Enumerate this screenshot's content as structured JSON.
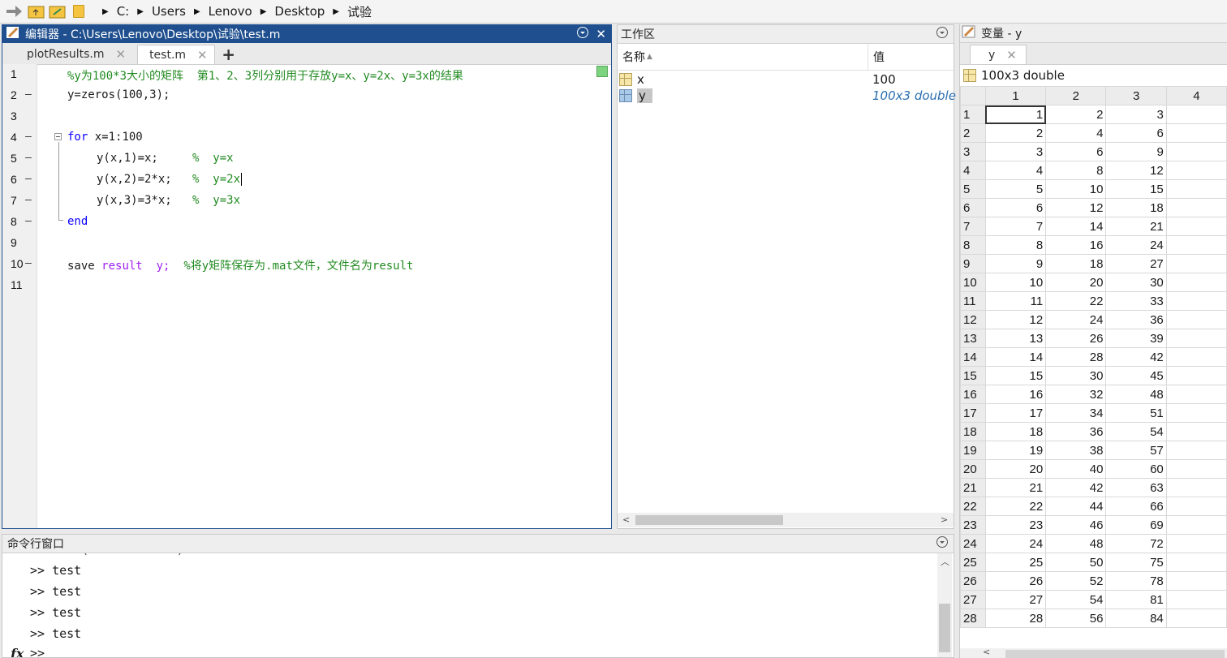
{
  "address_bar": {
    "crumbs": [
      "C:",
      "Users",
      "Lenovo",
      "Desktop",
      "试验"
    ]
  },
  "editor": {
    "title": "编辑器 - C:\\Users\\Lenovo\\Desktop\\试验\\test.m",
    "tabs": [
      {
        "label": "plotResults.m",
        "close": "✕"
      },
      {
        "label": "test.m",
        "close": "✕"
      }
    ],
    "new_tab_label": "+",
    "lines": [
      {
        "n": "1",
        "dash": ""
      },
      {
        "n": "2",
        "dash": "—"
      },
      {
        "n": "3",
        "dash": ""
      },
      {
        "n": "4",
        "dash": "—"
      },
      {
        "n": "5",
        "dash": "—"
      },
      {
        "n": "6",
        "dash": "—"
      },
      {
        "n": "7",
        "dash": "—"
      },
      {
        "n": "8",
        "dash": "—"
      },
      {
        "n": "9",
        "dash": ""
      },
      {
        "n": "10",
        "dash": "—"
      },
      {
        "n": "11",
        "dash": ""
      }
    ],
    "code": {
      "l1_comment": "%y为100*3大小的矩阵  第1、2、3列分别用于存放y=x、y=2x、y=3x的结果",
      "l2": "y=zeros(100,3);",
      "l4_kw": "for",
      "l4_rest": " x=1:100",
      "l5_code": "y(x,1)=x;     ",
      "l5_comment": "%  y=x",
      "l6_code": "y(x,2)=2*x;   ",
      "l6_comment": "%  y=2x",
      "l7_code": "y(x,3)=3*x;   ",
      "l7_comment": "%  y=3x",
      "l8_kw": "end",
      "l10_cmd": "save ",
      "l10_arg1": "result",
      "l10_sp": "  ",
      "l10_arg2": "y;",
      "l10_sp2": "  ",
      "l10_comment": "%将y矩阵保存为.mat文件，文件名为result"
    }
  },
  "workspace": {
    "title": "工作区",
    "col_name": "名称",
    "sort_glyph": "▲",
    "col_value": "值",
    "rows": [
      {
        "name": "x",
        "value": "100"
      },
      {
        "name": "y",
        "value": "100x3 double"
      }
    ]
  },
  "variables": {
    "title": "变量 - y",
    "tab_label": "y",
    "tab_close": "✕",
    "size_label": "100x3 double",
    "col_headers": [
      "1",
      "2",
      "3",
      "4"
    ],
    "rows": [
      [
        "1",
        "1",
        "2",
        "3"
      ],
      [
        "2",
        "2",
        "4",
        "6"
      ],
      [
        "3",
        "3",
        "6",
        "9"
      ],
      [
        "4",
        "4",
        "8",
        "12"
      ],
      [
        "5",
        "5",
        "10",
        "15"
      ],
      [
        "6",
        "6",
        "12",
        "18"
      ],
      [
        "7",
        "7",
        "14",
        "21"
      ],
      [
        "8",
        "8",
        "16",
        "24"
      ],
      [
        "9",
        "9",
        "18",
        "27"
      ],
      [
        "10",
        "10",
        "20",
        "30"
      ],
      [
        "11",
        "11",
        "22",
        "33"
      ],
      [
        "12",
        "12",
        "24",
        "36"
      ],
      [
        "13",
        "13",
        "26",
        "39"
      ],
      [
        "14",
        "14",
        "28",
        "42"
      ],
      [
        "15",
        "15",
        "30",
        "45"
      ],
      [
        "16",
        "16",
        "32",
        "48"
      ],
      [
        "17",
        "17",
        "34",
        "51"
      ],
      [
        "18",
        "18",
        "36",
        "54"
      ],
      [
        "19",
        "19",
        "38",
        "57"
      ],
      [
        "20",
        "20",
        "40",
        "60"
      ],
      [
        "21",
        "21",
        "42",
        "63"
      ],
      [
        "22",
        "22",
        "44",
        "66"
      ],
      [
        "23",
        "23",
        "46",
        "69"
      ],
      [
        "24",
        "24",
        "48",
        "72"
      ],
      [
        "25",
        "25",
        "50",
        "75"
      ],
      [
        "26",
        "26",
        "52",
        "78"
      ],
      [
        "27",
        "27",
        "54",
        "81"
      ],
      [
        "28",
        "28",
        "56",
        "84"
      ]
    ]
  },
  "command_window": {
    "title": "命令行窗口",
    "partial_line": ">> load('result.mat')",
    "history": [
      ">> test",
      ">> test",
      ">> test",
      ">> test"
    ],
    "prompt": ">>",
    "fx_label": "fx"
  }
}
